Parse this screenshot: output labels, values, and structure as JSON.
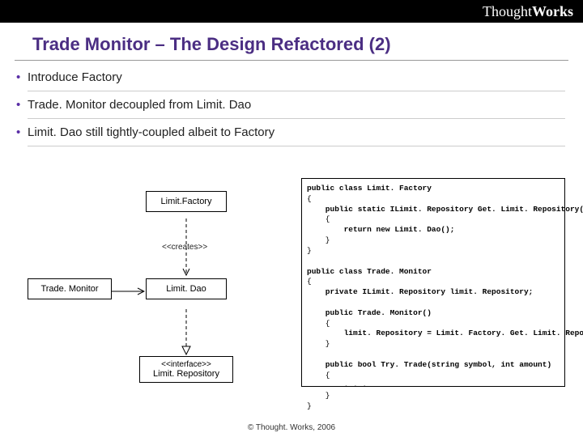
{
  "brand": {
    "prefix": "Thought",
    "suffix": "Works"
  },
  "title": "Trade Monitor – The Design Refactored (2)",
  "bullets": [
    "Introduce Factory",
    "Trade. Monitor decoupled from Limit. Dao",
    "Limit. Dao still tightly-coupled albeit to Factory"
  ],
  "uml": {
    "factory": "Limit.Factory",
    "creates": "<<creates>>",
    "monitor": "Trade. Monitor",
    "dao": "Limit. Dao",
    "iface_stereo": "<<interface>>",
    "iface_name": "Limit. Repository"
  },
  "code": {
    "l1": "public class Limit. Factory",
    "l2": "{",
    "l3": "    public static ILimit. Repository Get. Limit. Repository()",
    "l4": "    {",
    "l5": "        return new Limit. Dao();",
    "l6": "    }",
    "l7": "}",
    "l8": "",
    "l9": "public class Trade. Monitor",
    "l10": "{",
    "l11": "    private ILimit. Repository limit. Repository;",
    "l12": "",
    "l13": "    public Trade. Monitor()",
    "l14": "    {",
    "l15": "        limit. Repository = Limit. Factory. Get. Limit. Repository();",
    "l16": "    }",
    "l17": "",
    "l18": "    public bool Try. Trade(string symbol, int amount)",
    "l19": "    {",
    "l20": "        . . .",
    "l21": "    }",
    "l22": "}"
  },
  "footer": "© Thought. Works, 2006"
}
